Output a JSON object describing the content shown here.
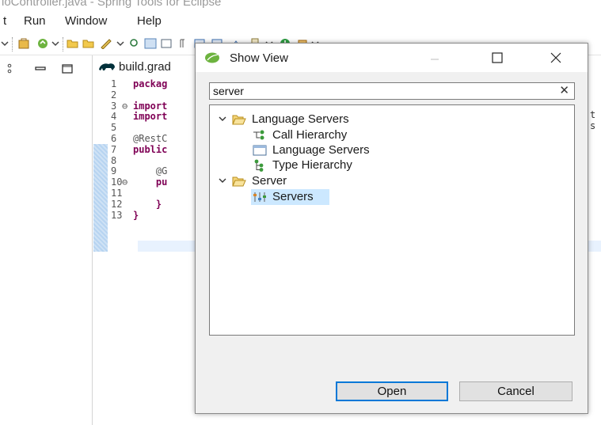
{
  "window": {
    "title": "loController.java - Spring Tools for Eclipse"
  },
  "menu": [
    {
      "label": "t"
    },
    {
      "label": "Run"
    },
    {
      "label": "Window"
    },
    {
      "label": "Help"
    }
  ],
  "editor": {
    "tab_label": "build.grad",
    "lines": [
      {
        "num": "1",
        "marker": "",
        "code": "packag"
      },
      {
        "num": "2",
        "marker": "",
        "code": ""
      },
      {
        "num": "3",
        "marker": "⊖",
        "code": "import"
      },
      {
        "num": "4",
        "marker": "",
        "code": "import"
      },
      {
        "num": "5",
        "marker": "",
        "code": ""
      },
      {
        "num": "6",
        "marker": "",
        "code": "@RestC"
      },
      {
        "num": "7",
        "marker": "",
        "code": "public"
      },
      {
        "num": "8",
        "marker": "",
        "code": ""
      },
      {
        "num": "9",
        "marker": "",
        "code": "    @G"
      },
      {
        "num": "10",
        "marker": "⊖",
        "code": "    pu"
      },
      {
        "num": "11",
        "marker": "",
        "code": ""
      },
      {
        "num": "12",
        "marker": "",
        "code": "    }"
      },
      {
        "num": "13",
        "marker": "",
        "code": "}"
      }
    ],
    "right_fragments": [
      "t",
      "s"
    ]
  },
  "dialog": {
    "title": "Show View",
    "filter_value": "server",
    "clear_label": "✕",
    "tree": {
      "categories": [
        {
          "label": "Language Servers",
          "icon": "folder-open-icon",
          "children": [
            {
              "label": "Call Hierarchy",
              "icon": "call-hierarchy-icon"
            },
            {
              "label": "Language Servers",
              "icon": "view-window-icon"
            },
            {
              "label": "Type Hierarchy",
              "icon": "type-hierarchy-icon"
            }
          ]
        },
        {
          "label": "Server",
          "icon": "folder-open-icon",
          "children": [
            {
              "label": "Servers",
              "icon": "servers-icon",
              "selected": true
            }
          ]
        }
      ]
    },
    "buttons": {
      "open": "Open",
      "cancel": "Cancel"
    }
  },
  "colors": {
    "selection": "#cce8ff",
    "keyword": "#7f0055",
    "primary_button_border": "#0078d7",
    "spring_green": "#6db33f"
  }
}
